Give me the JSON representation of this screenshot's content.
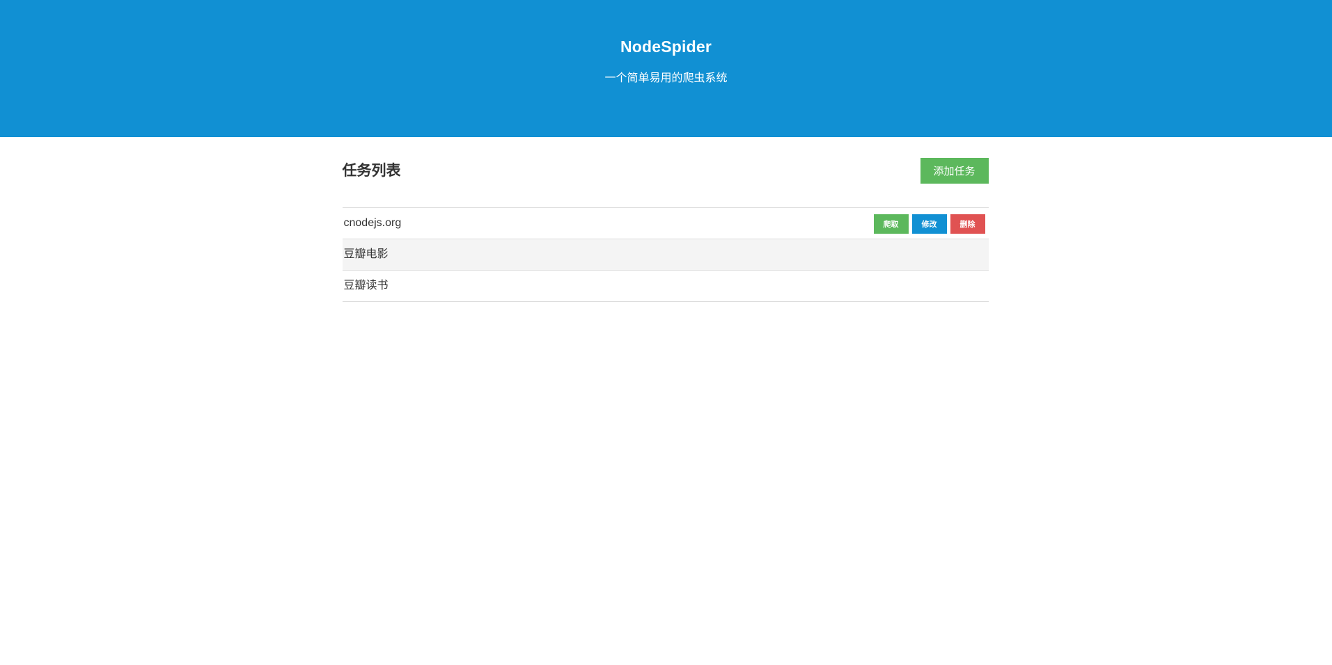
{
  "hero": {
    "title": "NodeSpider",
    "subtitle": "一个简单易用的爬虫系统"
  },
  "main": {
    "title": "任务列表",
    "add_button_label": "添加任务"
  },
  "tasks": [
    {
      "name": "cnodejs.org",
      "actions": [
        {
          "label": "爬取",
          "color": "#5cb85c"
        },
        {
          "label": "修改",
          "color": "#1190d3"
        },
        {
          "label": "删除",
          "color": "#e05252"
        }
      ]
    },
    {
      "name": "豆瓣电影"
    },
    {
      "name": "豆瓣读书"
    }
  ],
  "colors": {
    "hero_background": "#1190d3",
    "success": "#5cb85c",
    "primary": "#1190d3",
    "danger": "#e05252"
  }
}
